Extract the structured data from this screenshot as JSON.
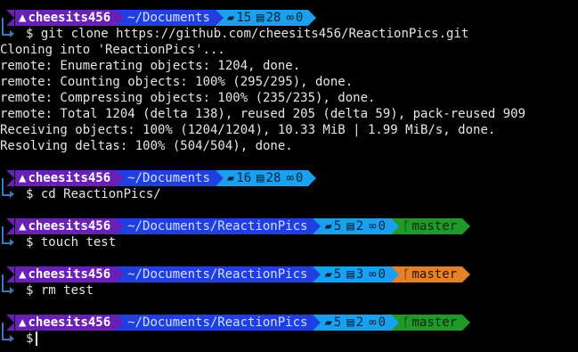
{
  "colors": {
    "user_bg": "#6a1fb8",
    "path_bg": "#1f3fe0",
    "stats_bg": "#1aa0ee",
    "git_clean_bg": "#1f9a2a",
    "git_dirty_bg": "#e4822a",
    "bracket": "#3a78c0"
  },
  "prompt_symbol": "$",
  "prompts": [
    {
      "user": "cheesits456",
      "path": "~/Documents",
      "dirs": "15",
      "files": "28",
      "links": "0",
      "git": "",
      "cmd": "git clone https://github.com/cheesits456/ReactionPics.git"
    },
    {
      "user": "cheesits456",
      "path": "~/Documents",
      "dirs": "16",
      "files": "28",
      "links": "0",
      "git": "",
      "cmd": "cd ReactionPics/"
    },
    {
      "user": "cheesits456",
      "path": "~/Documents/ReactionPics",
      "dirs": "5",
      "files": "2",
      "links": "0",
      "git": "master",
      "cmd": "touch test"
    },
    {
      "user": "cheesits456",
      "path": "~/Documents/ReactionPics",
      "dirs": "5",
      "files": "3",
      "links": "0",
      "git": "master",
      "cmd": "rm test"
    },
    {
      "user": "cheesits456",
      "path": "~/Documents/ReactionPics",
      "dirs": "5",
      "files": "2",
      "links": "0",
      "git": "master",
      "cmd": ""
    }
  ],
  "output": [
    "Cloning into 'ReactionPics'...",
    "remote: Enumerating objects: 1204, done.",
    "remote: Counting objects: 100% (295/295), done.",
    "remote: Compressing objects: 100% (235/235), done.",
    "remote: Total 1204 (delta 138), reused 205 (delta 59), pack-reused 909",
    "Receiving objects: 100% (1204/1204), 10.33 MiB | 1.99 MiB/s, done.",
    "Resolving deltas: 100% (504/504), done."
  ],
  "icons": {
    "distro": "arch-logo-icon",
    "folder": "folder-icon",
    "file": "file-icon",
    "link": "link-icon",
    "branch": "git-branch-icon"
  }
}
